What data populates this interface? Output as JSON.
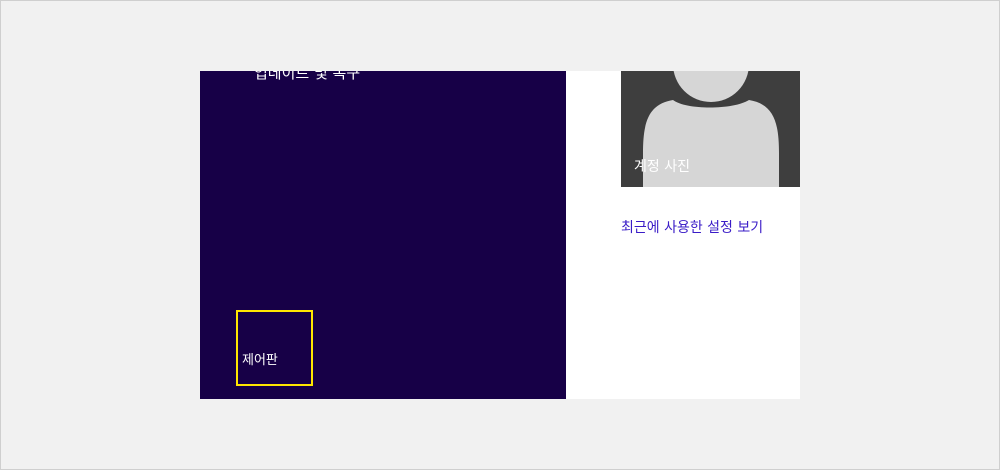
{
  "left_pane": {
    "nav_item_label": "업데이트 및 복구",
    "control_panel_label": "제어판"
  },
  "right_pane": {
    "account_picture_label": "계정 사진",
    "recent_settings_link": "최근에 사용한 설정 보기"
  },
  "colors": {
    "page_background": "#f1f1f1",
    "left_pane_background": "#170047",
    "focus_border": "#ffe600",
    "account_tile_background": "#3e3e3e",
    "avatar_silhouette": "#d6d6d6",
    "link_color": "#3a1cc7"
  },
  "icons": {
    "account_picture": "user-silhouette-icon"
  }
}
